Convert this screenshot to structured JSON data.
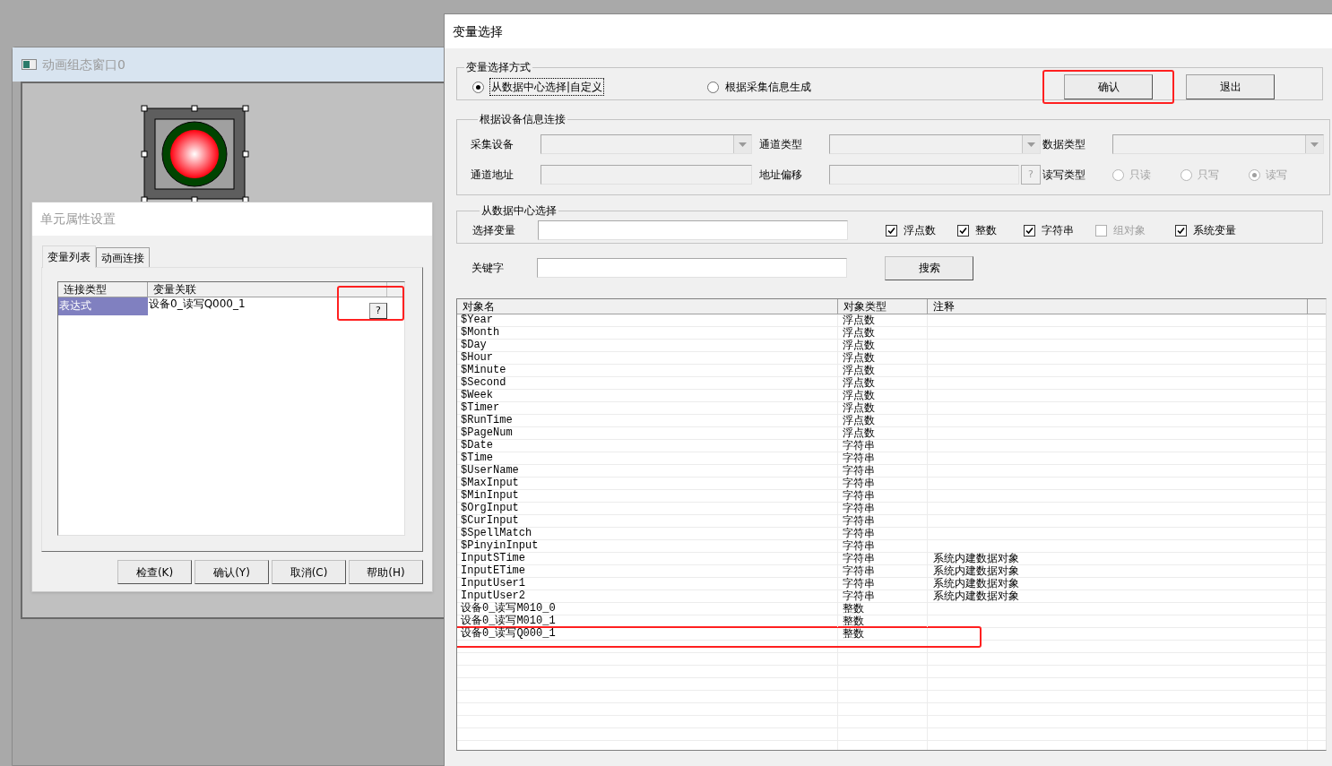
{
  "background_window": {
    "title": "动画组态窗口0"
  },
  "property_dialog": {
    "title": "单元属性设置",
    "tabs": [
      {
        "label": "变量列表",
        "selected": true
      },
      {
        "label": "动画连接",
        "selected": false
      }
    ],
    "table": {
      "columns": [
        "连接类型",
        "变量关联"
      ],
      "rows": [
        {
          "type": "表达式",
          "variable": "设备0_读写Q000_1",
          "button": "?",
          "selected": true,
          "highlighted": true
        }
      ]
    },
    "buttons": [
      "检查(K)",
      "确认(Y)",
      "取消(C)",
      "帮助(H)"
    ]
  },
  "variable_dialog": {
    "title": "变量选择",
    "mode_group": {
      "title": "变量选择方式",
      "options": [
        {
          "label": "从数据中心选择|自定义",
          "selected": true
        },
        {
          "label": "根据采集信息生成",
          "selected": false
        }
      ],
      "buttons": [
        {
          "label": "确认",
          "highlighted": true
        },
        {
          "label": "退出",
          "highlighted": false
        }
      ]
    },
    "device_group": {
      "title": "根据设备信息连接",
      "fields": [
        {
          "label": "采集设备",
          "kind": "combo",
          "disabled": true
        },
        {
          "label": "通道类型",
          "kind": "combo",
          "disabled": true
        },
        {
          "label": "数据类型",
          "kind": "combo",
          "disabled": true
        },
        {
          "label": "通道地址",
          "kind": "text",
          "disabled": true
        },
        {
          "label": "地址偏移",
          "kind": "text_button",
          "button": "?",
          "disabled": true
        },
        {
          "label": "读写类型",
          "kind": "radios",
          "options": [
            {
              "label": "只读",
              "selected": false,
              "disabled": true
            },
            {
              "label": "只写",
              "selected": false,
              "disabled": true
            },
            {
              "label": "读写",
              "selected": true,
              "disabled": true
            }
          ]
        }
      ]
    },
    "center_group": {
      "title": "从数据中心选择",
      "field_label": "选择变量",
      "filters": [
        {
          "label": "浮点数",
          "checked": true,
          "disabled": false
        },
        {
          "label": "整数",
          "checked": true,
          "disabled": false
        },
        {
          "label": "字符串",
          "checked": true,
          "disabled": false
        },
        {
          "label": "组对象",
          "checked": false,
          "disabled": true
        },
        {
          "label": "系统变量",
          "checked": true,
          "disabled": false
        }
      ]
    },
    "keyword": {
      "label": "关键字",
      "button": "搜索"
    },
    "table": {
      "columns": [
        "对象名",
        "对象类型",
        "注释"
      ],
      "rows": [
        {
          "name": "$Year",
          "type": "浮点数",
          "highlighted": false
        },
        {
          "name": "$Month",
          "type": "浮点数",
          "highlighted": false
        },
        {
          "name": "$Day",
          "type": "浮点数",
          "highlighted": false
        },
        {
          "name": "$Hour",
          "type": "浮点数",
          "highlighted": false
        },
        {
          "name": "$Minute",
          "type": "浮点数",
          "highlighted": false
        },
        {
          "name": "$Second",
          "type": "浮点数",
          "highlighted": false
        },
        {
          "name": "$Week",
          "type": "浮点数",
          "highlighted": false
        },
        {
          "name": "$Timer",
          "type": "浮点数",
          "highlighted": false
        },
        {
          "name": "$RunTime",
          "type": "浮点数",
          "highlighted": false
        },
        {
          "name": "$PageNum",
          "type": "浮点数",
          "highlighted": false
        },
        {
          "name": "$Date",
          "type": "字符串",
          "highlighted": false
        },
        {
          "name": "$Time",
          "type": "字符串",
          "highlighted": false
        },
        {
          "name": "$UserName",
          "type": "字符串",
          "highlighted": false
        },
        {
          "name": "$MaxInput",
          "type": "字符串",
          "highlighted": false
        },
        {
          "name": "$MinInput",
          "type": "字符串",
          "highlighted": false
        },
        {
          "name": "$OrgInput",
          "type": "字符串",
          "highlighted": false
        },
        {
          "name": "$CurInput",
          "type": "字符串",
          "highlighted": false
        },
        {
          "name": "$SpellMatch",
          "type": "字符串",
          "highlighted": false
        },
        {
          "name": "$PinyinInput",
          "type": "字符串",
          "highlighted": false
        },
        {
          "name": "InputSTime",
          "type": "字符串",
          "comment": "系统内建数据对象",
          "highlighted": false
        },
        {
          "name": "InputETime",
          "type": "字符串",
          "comment": "系统内建数据对象",
          "highlighted": false
        },
        {
          "name": "InputUser1",
          "type": "字符串",
          "comment": "系统内建数据对象",
          "highlighted": false
        },
        {
          "name": "InputUser2",
          "type": "字符串",
          "comment": "系统内建数据对象",
          "highlighted": false
        },
        {
          "name": "设备0_读写M010_0",
          "type": "整数",
          "highlighted": false
        },
        {
          "name": "设备0_读写M010_1",
          "type": "整数",
          "highlighted": false
        },
        {
          "name": "设备0_读写Q000_1",
          "type": "整数",
          "highlighted": true
        }
      ]
    }
  }
}
